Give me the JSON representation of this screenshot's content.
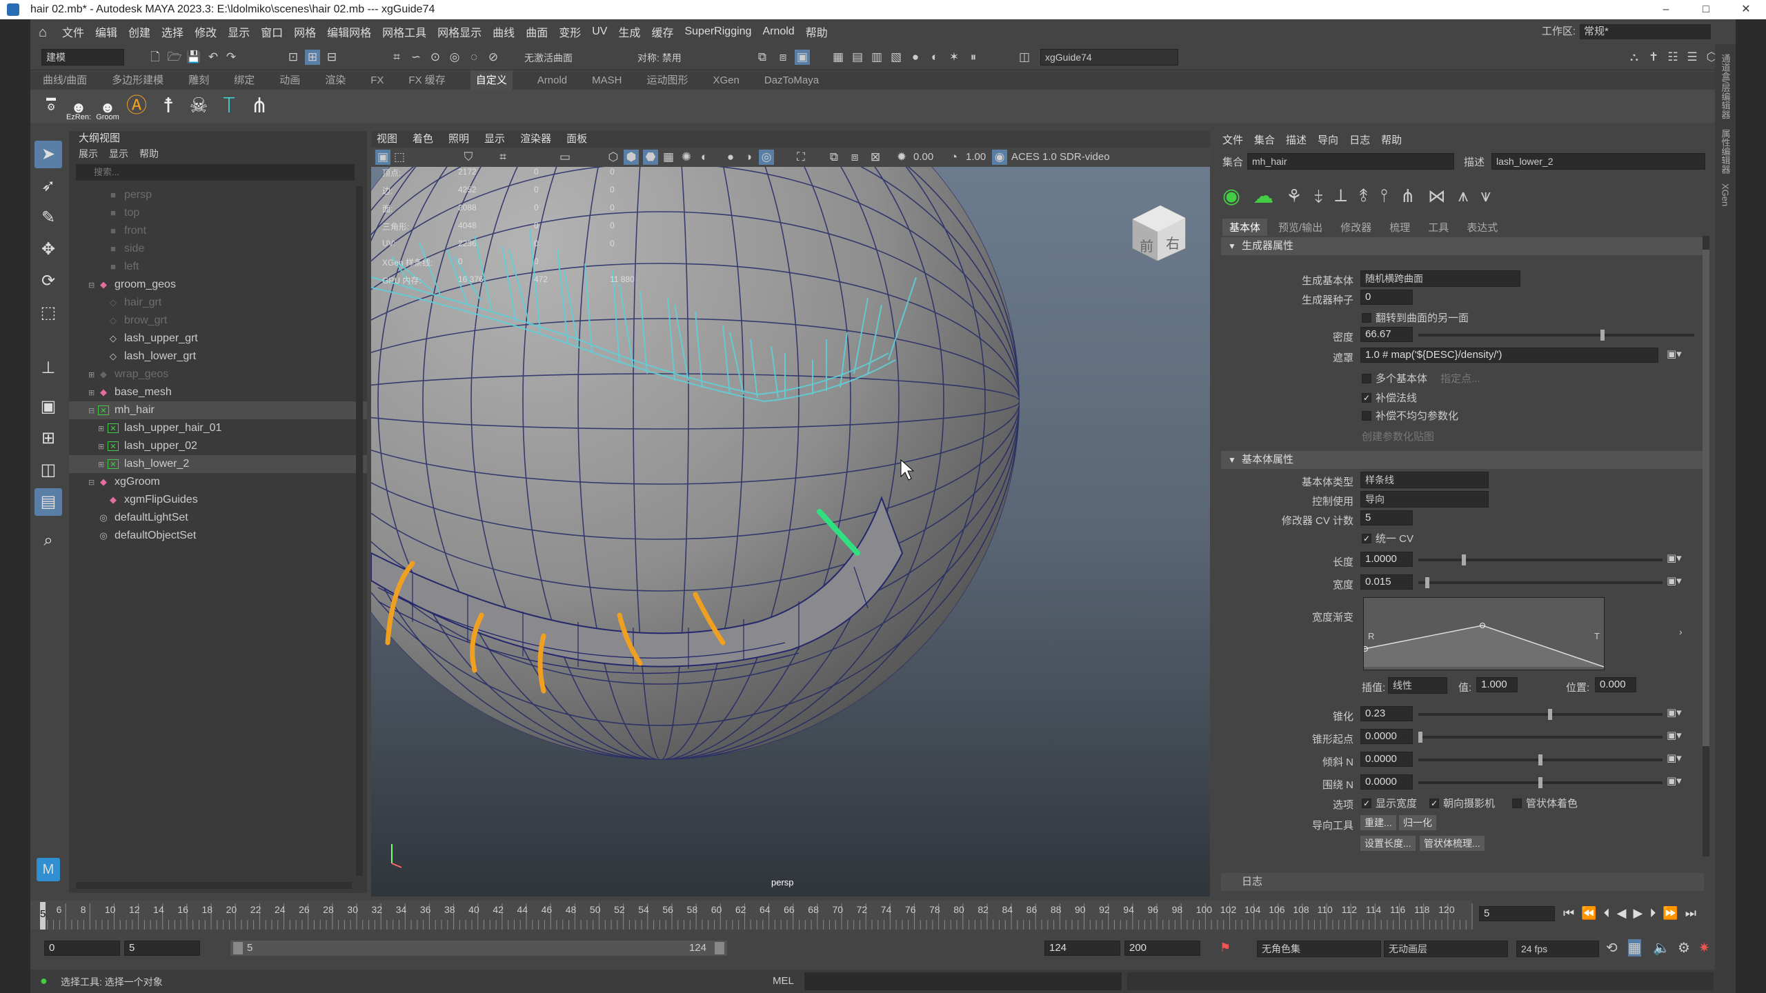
{
  "window": {
    "title": "hair 02.mb* - Autodesk MAYA 2023.3: E:\\ldolmiko\\scenes\\hair 02.mb  ---  xgGuide74",
    "minimize": "–",
    "maximize": "□",
    "close": "✕"
  },
  "menubar": {
    "items": [
      "文件",
      "编辑",
      "创建",
      "选择",
      "修改",
      "显示",
      "窗口",
      "网格",
      "编辑网格",
      "网格工具",
      "网格显示",
      "曲线",
      "曲面",
      "变形",
      "UV",
      "生成",
      "缓存",
      "SuperRigging",
      "Arnold",
      "帮助"
    ],
    "workspace_label": "工作区:",
    "workspace_value": "常规*"
  },
  "statusline": {
    "mode": "建模",
    "live_surface": "无激活曲面",
    "symmetry": "对称: 禁用",
    "object_name": "xgGuide74"
  },
  "shelf": {
    "tabs": [
      "曲线/曲面",
      "多边形建模",
      "雕刻",
      "绑定",
      "动画",
      "渲染",
      "FX",
      "FX 缓存",
      "自定义",
      "Arnold",
      "MASH",
      "运动图形",
      "XGen",
      "DazToMaya"
    ],
    "active_tab": "自定义",
    "labels": [
      "EzRen:",
      "Groom"
    ]
  },
  "outliner": {
    "title": "大纲视图",
    "menu": [
      "展示",
      "显示",
      "帮助"
    ],
    "search_placeholder": "搜索...",
    "items": [
      {
        "label": "persp",
        "dim": true,
        "indent": 1,
        "icon": "camera"
      },
      {
        "label": "top",
        "dim": true,
        "indent": 1,
        "icon": "camera"
      },
      {
        "label": "front",
        "dim": true,
        "indent": 1,
        "icon": "camera"
      },
      {
        "label": "side",
        "dim": true,
        "indent": 1,
        "icon": "camera"
      },
      {
        "label": "left",
        "dim": true,
        "indent": 1,
        "icon": "camera"
      },
      {
        "label": "groom_geos",
        "indent": 0,
        "icon": "mesh",
        "expand": "⊟"
      },
      {
        "label": "hair_grt",
        "dim": true,
        "indent": 1,
        "icon": "xform"
      },
      {
        "label": "brow_grt",
        "dim": true,
        "indent": 1,
        "icon": "xform"
      },
      {
        "label": "lash_upper_grt",
        "indent": 1,
        "icon": "xform"
      },
      {
        "label": "lash_lower_grt",
        "indent": 1,
        "icon": "xform"
      },
      {
        "label": "wrap_geos",
        "dim": true,
        "indent": 0,
        "icon": "mesh",
        "expand": "⊞"
      },
      {
        "label": "base_mesh",
        "indent": 0,
        "icon": "mesh",
        "expand": "⊞"
      },
      {
        "label": "mh_hair",
        "indent": 0,
        "icon": "xgen",
        "expand": "⊟",
        "sel": true
      },
      {
        "label": "lash_upper_hair_01",
        "indent": 1,
        "icon": "xgen",
        "expand": "⊞"
      },
      {
        "label": "lash_upper_02",
        "indent": 1,
        "icon": "xgen",
        "expand": "⊞"
      },
      {
        "label": "lash_lower_2",
        "indent": 1,
        "icon": "xgen",
        "expand": "⊞",
        "sel": true
      },
      {
        "label": "xgGroom",
        "indent": 0,
        "icon": "mesh",
        "expand": "⊟"
      },
      {
        "label": "xgmFlipGuides",
        "indent": 1,
        "icon": "mesh"
      },
      {
        "label": "defaultLightSet",
        "indent": 0,
        "icon": "set"
      },
      {
        "label": "defaultObjectSet",
        "indent": 0,
        "icon": "set"
      }
    ]
  },
  "viewport": {
    "menu": [
      "视图",
      "着色",
      "照明",
      "显示",
      "渲染器",
      "面板"
    ],
    "exposure": "0.00",
    "gamma": "1.00",
    "colorspace": "ACES 1.0 SDR-video",
    "camera": "persp",
    "cube_front": "前",
    "cube_right": "右",
    "hud": [
      {
        "label": "顶点:",
        "a": "2172",
        "b": "0",
        "c": "0"
      },
      {
        "label": "边:",
        "a": "4252",
        "b": "0",
        "c": "0"
      },
      {
        "label": "面:",
        "a": "2088",
        "b": "0",
        "c": "0"
      },
      {
        "label": "三角形:",
        "a": "4048",
        "b": "0",
        "c": "0"
      },
      {
        "label": "UV:",
        "a": "2236",
        "b": "0",
        "c": "0"
      },
      {
        "label": "XGen 样条线:",
        "a": "0",
        "b": "0",
        "c": ""
      },
      {
        "label": "GPU 内存:",
        "a": "16 376",
        "b": "472",
        "c": "11 880"
      }
    ]
  },
  "xgen": {
    "menu": [
      "文件",
      "集合",
      "描述",
      "导向",
      "日志",
      "帮助"
    ],
    "collection_label": "集合",
    "collection_value": "mh_hair",
    "description_label": "描述",
    "description_value": "lash_lower_2",
    "tabs": [
      "基本体",
      "预览/输出",
      "修改器",
      "梳理",
      "工具",
      "表达式"
    ],
    "active_tab": "基本体",
    "gen_section": "生成器属性",
    "generator_label": "生成基本体",
    "generator_value": "随机横跨曲面",
    "seed_label": "生成器种子",
    "seed_value": "0",
    "flip_label": "翻转到曲面的另一面",
    "density_label": "密度",
    "density_value": "66.67",
    "density_level": 0.67,
    "mask_label": "遮罩",
    "mask_value": "1.0 # map('${DESC}/density/')",
    "multi_label": "多个基本体",
    "specify_label": "指定点...",
    "normals_label": "补偿法线",
    "uneven_label": "补偿不均匀参数化",
    "create_map_label": "创建参数化贴图",
    "prim_section": "基本体属性",
    "prim_type_label": "基本体类型",
    "prim_type_value": "样条线",
    "control_label": "控制使用",
    "control_value": "导向",
    "cv_label": "修改器 CV 计数",
    "cv_value": "5",
    "unify_label": "统一 CV",
    "length_label": "长度",
    "length_value": "1.0000",
    "length_level": 0.18,
    "width_label": "宽度",
    "width_value": "0.015",
    "width_level": 0.03,
    "ramp_label": "宽度渐变",
    "ramp_R": "R",
    "ramp_T": "T",
    "interp_label": "插值:",
    "interp_value": "线性",
    "val_label": "值:",
    "val_value": "1.000",
    "pos_label": "位置:",
    "pos_value": "0.000",
    "taper_label": "锥化",
    "taper_value": "0.23",
    "taper_level": 0.54,
    "taper_start_label": "锥形起点",
    "taper_start_value": "0.0000",
    "taper_start_level": 0.0,
    "tilt_label": "倾斜 N",
    "tilt_value": "0.0000",
    "tilt_level": 0.5,
    "around_label": "围绕 N",
    "around_value": "0.0000",
    "around_level": 0.5,
    "options_label": "选项",
    "show_width_label": "显示宽度",
    "face_cam_label": "朝向摄影机",
    "tube_label": "管状体着色",
    "guide_tools_label": "导向工具",
    "rebuild_label": "重建...",
    "normalize_label": "归一化",
    "set_length_label": "设置长度...",
    "tube_groom_label": "管状体梳理...",
    "log_label": "日志"
  },
  "timeline": {
    "ticks": [
      "6",
      "8",
      "10",
      "12",
      "14",
      "16",
      "18",
      "20",
      "22",
      "24",
      "26",
      "28",
      "30",
      "32",
      "34",
      "36",
      "38",
      "40",
      "42",
      "44",
      "46",
      "48",
      "50",
      "52",
      "54",
      "56",
      "58",
      "60",
      "62",
      "64",
      "66",
      "68",
      "70",
      "72",
      "74",
      "76",
      "78",
      "80",
      "82",
      "84",
      "86",
      "88",
      "90",
      "92",
      "94",
      "96",
      "98",
      "100",
      "102",
      "104",
      "106",
      "108",
      "110",
      "112",
      "114",
      "116",
      "118",
      "120"
    ],
    "current": "5",
    "frame_field": "5"
  },
  "range": {
    "start": "0",
    "start2": "5",
    "slider_start": "5",
    "slider_end": "124",
    "end": "124",
    "end2": "200",
    "char_set": "无角色集",
    "anim_layer": "无动画层",
    "fps": "24 fps"
  },
  "cmdline": {
    "lang": "MEL",
    "status": "选择工具: 选择一个对象"
  },
  "right_tabs": [
    "通道盒/层编辑器",
    "属性编辑器",
    "XGen"
  ]
}
